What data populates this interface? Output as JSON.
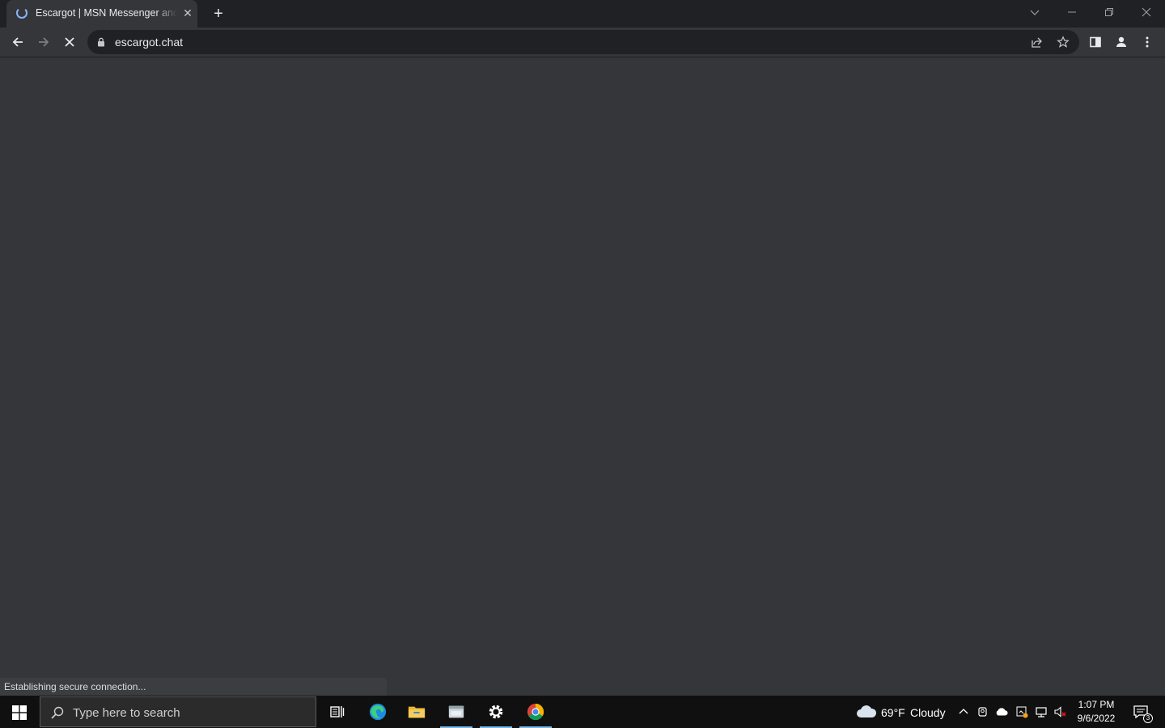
{
  "browser": {
    "tab": {
      "title": "Escargot | MSN Messenger and Windows Live Messenger",
      "loading": true
    },
    "address_bar": {
      "url": "escargot.chat",
      "secure": true
    },
    "status_text": "Establishing secure connection...",
    "theme": {
      "frame": "#202124",
      "toolbar": "#35363a",
      "accent": "#8ab4f8"
    }
  },
  "taskbar": {
    "search": {
      "placeholder": "Type here to search"
    },
    "apps": [
      {
        "name": "task-view",
        "icon": "task-view-icon",
        "active": false
      },
      {
        "name": "edge",
        "icon": "edge-icon",
        "active": false
      },
      {
        "name": "file-explorer",
        "icon": "folder-icon",
        "active": false
      },
      {
        "name": "app-window",
        "icon": "window-app-icon",
        "active": true
      },
      {
        "name": "settings",
        "icon": "gear-icon",
        "active": true
      },
      {
        "name": "chrome",
        "icon": "chrome-icon",
        "active": true
      }
    ],
    "weather": {
      "temp": "69°F",
      "condition": "Cloudy"
    },
    "clock": {
      "time": "1:07 PM",
      "date": "9/6/2022"
    },
    "notifications": {
      "count": "3"
    }
  }
}
